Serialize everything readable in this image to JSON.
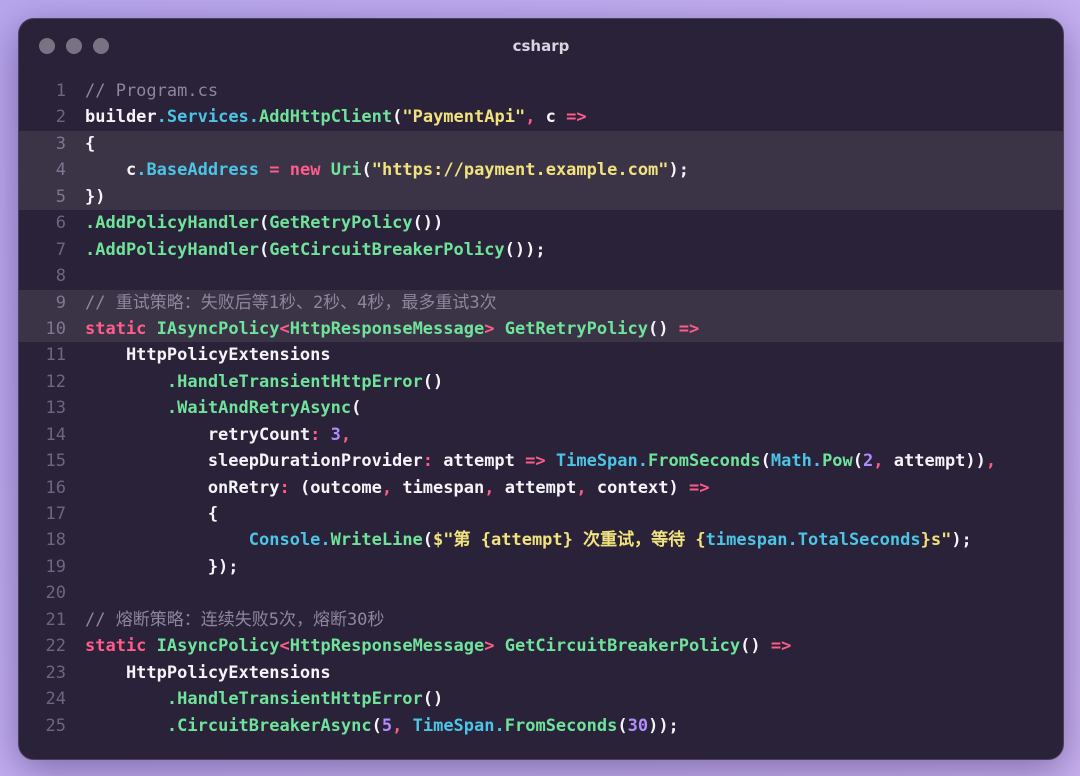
{
  "window": {
    "title": "csharp"
  },
  "code": {
    "language": "csharp",
    "highlighted_lines": [
      3,
      4,
      5,
      9,
      10
    ],
    "lines": [
      {
        "n": "1",
        "tokens": [
          [
            "cm",
            "// Program.cs"
          ]
        ]
      },
      {
        "n": "2",
        "tokens": [
          [
            "pu",
            "builder"
          ],
          [
            "ty",
            "."
          ],
          [
            "ty",
            "Services"
          ],
          [
            "ty",
            "."
          ],
          [
            "fn",
            "AddHttpClient"
          ],
          [
            "pu",
            "("
          ],
          [
            "str",
            "\"PaymentApi\""
          ],
          [
            "op",
            ","
          ],
          [
            "pu",
            " c "
          ],
          [
            "op",
            "=>"
          ]
        ]
      },
      {
        "n": "3",
        "tokens": [
          [
            "pu",
            "{"
          ]
        ]
      },
      {
        "n": "4",
        "tokens": [
          [
            "pu",
            "    c"
          ],
          [
            "ty",
            "."
          ],
          [
            "ty",
            "BaseAddress"
          ],
          [
            "pu",
            " "
          ],
          [
            "op",
            "="
          ],
          [
            "pu",
            " "
          ],
          [
            "kw",
            "new"
          ],
          [
            "pu",
            " "
          ],
          [
            "fn",
            "Uri"
          ],
          [
            "pu",
            "("
          ],
          [
            "str",
            "\"https://payment.example.com\""
          ],
          [
            "pu",
            ");"
          ]
        ]
      },
      {
        "n": "5",
        "tokens": [
          [
            "pu",
            "})"
          ]
        ]
      },
      {
        "n": "6",
        "tokens": [
          [
            "fn",
            "."
          ],
          [
            "fn",
            "AddPolicyHandler"
          ],
          [
            "pu",
            "("
          ],
          [
            "fn",
            "GetRetryPolicy"
          ],
          [
            "pu",
            "())"
          ]
        ]
      },
      {
        "n": "7",
        "tokens": [
          [
            "fn",
            "."
          ],
          [
            "fn",
            "AddPolicyHandler"
          ],
          [
            "pu",
            "("
          ],
          [
            "fn",
            "GetCircuitBreakerPolicy"
          ],
          [
            "pu",
            "());"
          ]
        ]
      },
      {
        "n": "8",
        "tokens": []
      },
      {
        "n": "9",
        "tokens": [
          [
            "cm",
            "// 重试策略：失败后等1秒、2秒、4秒，最多重试3次"
          ]
        ]
      },
      {
        "n": "10",
        "tokens": [
          [
            "kw",
            "static"
          ],
          [
            "pu",
            " "
          ],
          [
            "fn",
            "IAsyncPolicy"
          ],
          [
            "op",
            "<"
          ],
          [
            "fn",
            "HttpResponseMessage"
          ],
          [
            "op",
            ">"
          ],
          [
            "pu",
            " "
          ],
          [
            "fn",
            "GetRetryPolicy"
          ],
          [
            "pu",
            "() "
          ],
          [
            "op",
            "=>"
          ]
        ]
      },
      {
        "n": "11",
        "tokens": [
          [
            "pu",
            "    HttpPolicyExtensions"
          ]
        ]
      },
      {
        "n": "12",
        "tokens": [
          [
            "pu",
            "        "
          ],
          [
            "fn",
            "."
          ],
          [
            "fn",
            "HandleTransientHttpError"
          ],
          [
            "pu",
            "()"
          ]
        ]
      },
      {
        "n": "13",
        "tokens": [
          [
            "pu",
            "        "
          ],
          [
            "fn",
            "."
          ],
          [
            "fn",
            "WaitAndRetryAsync"
          ],
          [
            "pu",
            "("
          ]
        ]
      },
      {
        "n": "14",
        "tokens": [
          [
            "pu",
            "            retryCount"
          ],
          [
            "op",
            ":"
          ],
          [
            "pu",
            " "
          ],
          [
            "num",
            "3"
          ],
          [
            "op",
            ","
          ]
        ]
      },
      {
        "n": "15",
        "tokens": [
          [
            "pu",
            "            sleepDurationProvider"
          ],
          [
            "op",
            ":"
          ],
          [
            "pu",
            " attempt "
          ],
          [
            "op",
            "=>"
          ],
          [
            "pu",
            " "
          ],
          [
            "ty",
            "TimeSpan"
          ],
          [
            "ty",
            "."
          ],
          [
            "fn",
            "FromSeconds"
          ],
          [
            "pu",
            "("
          ],
          [
            "ty",
            "Math"
          ],
          [
            "ty",
            "."
          ],
          [
            "fn",
            "Pow"
          ],
          [
            "pu",
            "("
          ],
          [
            "num",
            "2"
          ],
          [
            "op",
            ","
          ],
          [
            "pu",
            " attempt))"
          ],
          [
            "op",
            ","
          ]
        ]
      },
      {
        "n": "16",
        "tokens": [
          [
            "pu",
            "            onRetry"
          ],
          [
            "op",
            ":"
          ],
          [
            "pu",
            " (outcome"
          ],
          [
            "op",
            ","
          ],
          [
            "pu",
            " timespan"
          ],
          [
            "op",
            ","
          ],
          [
            "pu",
            " attempt"
          ],
          [
            "op",
            ","
          ],
          [
            "pu",
            " context) "
          ],
          [
            "op",
            "=>"
          ]
        ]
      },
      {
        "n": "17",
        "tokens": [
          [
            "pu",
            "            {"
          ]
        ]
      },
      {
        "n": "18",
        "tokens": [
          [
            "pu",
            "                "
          ],
          [
            "ty",
            "Console"
          ],
          [
            "ty",
            "."
          ],
          [
            "fn",
            "WriteLine"
          ],
          [
            "pu",
            "("
          ],
          [
            "str",
            "$\"第 "
          ],
          [
            "str",
            "{attempt}"
          ],
          [
            "str",
            " 次重试，等待 "
          ],
          [
            "str",
            "{"
          ],
          [
            "ty",
            "timespan"
          ],
          [
            "ty",
            "."
          ],
          [
            "ty",
            "TotalSeconds"
          ],
          [
            "str",
            "}s\""
          ],
          [
            "pu",
            ");"
          ]
        ]
      },
      {
        "n": "19",
        "tokens": [
          [
            "pu",
            "            });"
          ]
        ]
      },
      {
        "n": "20",
        "tokens": []
      },
      {
        "n": "21",
        "tokens": [
          [
            "cm",
            "// 熔断策略：连续失败5次，熔断30秒"
          ]
        ]
      },
      {
        "n": "22",
        "tokens": [
          [
            "kw",
            "static"
          ],
          [
            "pu",
            " "
          ],
          [
            "fn",
            "IAsyncPolicy"
          ],
          [
            "op",
            "<"
          ],
          [
            "fn",
            "HttpResponseMessage"
          ],
          [
            "op",
            ">"
          ],
          [
            "pu",
            " "
          ],
          [
            "fn",
            "GetCircuitBreakerPolicy"
          ],
          [
            "pu",
            "() "
          ],
          [
            "op",
            "=>"
          ]
        ]
      },
      {
        "n": "23",
        "tokens": [
          [
            "pu",
            "    HttpPolicyExtensions"
          ]
        ]
      },
      {
        "n": "24",
        "tokens": [
          [
            "pu",
            "        "
          ],
          [
            "fn",
            "."
          ],
          [
            "fn",
            "HandleTransientHttpError"
          ],
          [
            "pu",
            "()"
          ]
        ]
      },
      {
        "n": "25",
        "tokens": [
          [
            "pu",
            "        "
          ],
          [
            "fn",
            "."
          ],
          [
            "fn",
            "CircuitBreakerAsync"
          ],
          [
            "pu",
            "("
          ],
          [
            "num",
            "5"
          ],
          [
            "op",
            ","
          ],
          [
            "pu",
            " "
          ],
          [
            "ty",
            "TimeSpan"
          ],
          [
            "ty",
            "."
          ],
          [
            "fn",
            "FromSeconds"
          ],
          [
            "pu",
            "("
          ],
          [
            "num",
            "30"
          ],
          [
            "pu",
            "));"
          ]
        ]
      }
    ]
  }
}
